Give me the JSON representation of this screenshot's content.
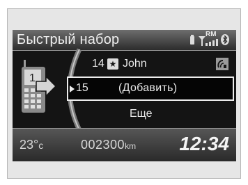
{
  "header": {
    "title": "Быстрый набор",
    "roaming": "RM",
    "icons": [
      "battery-icon",
      "signal-icon",
      "bluetooth-icon"
    ]
  },
  "speed_dial": {
    "entries": [
      {
        "number": "14",
        "name": "John",
        "icon": "star-icon",
        "has_voice_tag": true
      },
      {
        "number": "15",
        "name": "(Добавить)",
        "selected": true
      },
      {
        "name": "Еще"
      }
    ]
  },
  "footer": {
    "temperature": "23°",
    "temperature_unit": "c",
    "odometer": "002300",
    "odometer_unit": "km",
    "clock": "12:34"
  },
  "colors": {
    "screen_bg": "#151515",
    "text": "#e9e9e9",
    "highlight_border": "#ededed"
  }
}
